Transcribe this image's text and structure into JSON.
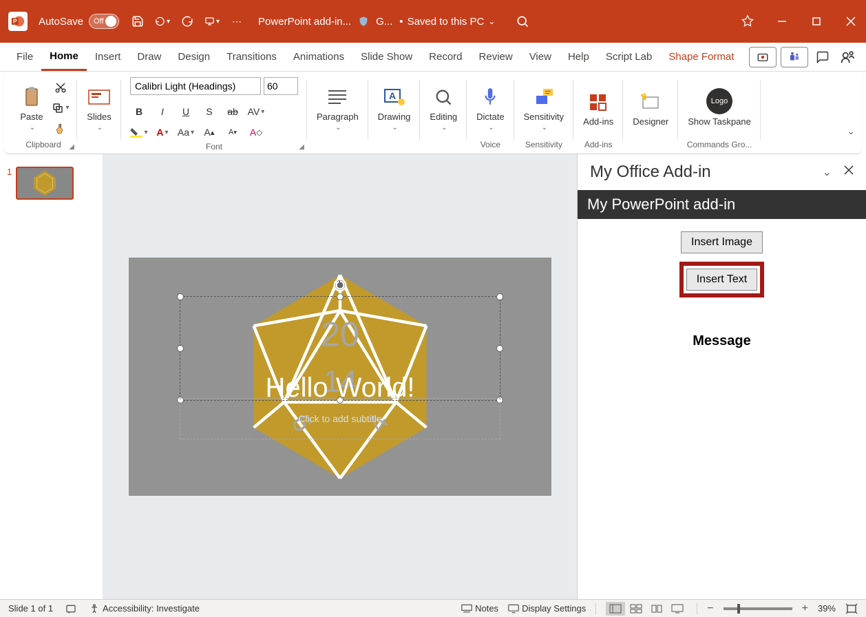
{
  "titlebar": {
    "autosave_label": "AutoSave",
    "autosave_state": "Off",
    "doc_name": "PowerPoint add-in...",
    "user_hint": "G...",
    "saved_text": "Saved to this PC"
  },
  "tabs": {
    "file": "File",
    "home": "Home",
    "insert": "Insert",
    "draw": "Draw",
    "design": "Design",
    "transitions": "Transitions",
    "animations": "Animations",
    "slideshow": "Slide Show",
    "record": "Record",
    "review": "Review",
    "view": "View",
    "help": "Help",
    "scriptlab": "Script Lab",
    "shapeformat": "Shape Format"
  },
  "ribbon": {
    "clipboard": {
      "label": "Clipboard",
      "paste": "Paste"
    },
    "slides": {
      "label": "Slides",
      "btn": "Slides"
    },
    "font": {
      "label": "Font",
      "name": "Calibri Light (Headings)",
      "size": "60"
    },
    "paragraph": {
      "label": "Paragraph"
    },
    "drawing": {
      "label": "Drawing"
    },
    "editing": {
      "label": "Editing"
    },
    "voice": {
      "label": "Voice",
      "dictate": "Dictate"
    },
    "sensitivity": {
      "label": "Sensitivity",
      "btn": "Sensitivity"
    },
    "addins": {
      "label": "Add-ins",
      "btn": "Add-ins"
    },
    "designer": {
      "label": "Designer"
    },
    "commands": {
      "label": "Commands Gro...",
      "show": "Show Taskpane",
      "logo": "Logo"
    }
  },
  "slide": {
    "number": "1",
    "title": "Hello World!",
    "subtitle_placeholder": "Click to add subtitle"
  },
  "taskpane": {
    "title": "My Office Add-in",
    "banner": "My PowerPoint add-in",
    "insert_image": "Insert Image",
    "insert_text": "Insert Text",
    "message": "Message"
  },
  "statusbar": {
    "slide_info": "Slide 1 of 1",
    "accessibility": "Accessibility: Investigate",
    "notes": "Notes",
    "display": "Display Settings",
    "zoom": "39%"
  }
}
